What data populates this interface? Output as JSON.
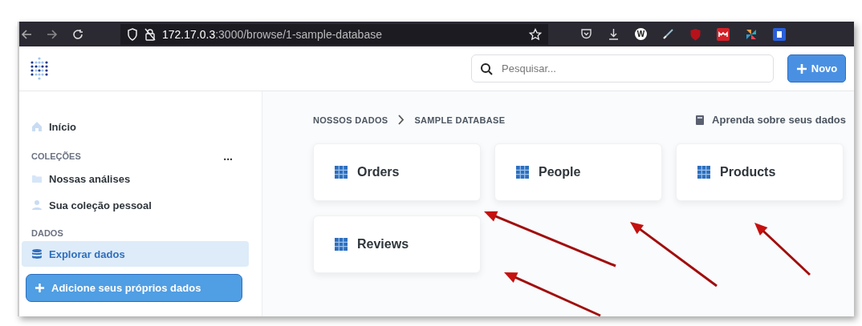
{
  "browser": {
    "url_host": "172.17.0.3",
    "url_path": ":3000/browse/1-sample-database",
    "extension_letter": "W"
  },
  "header": {
    "search": {
      "placeholder": "Pesquisar..."
    },
    "new_button": "Novo"
  },
  "sidebar": {
    "items": [
      {
        "kind": "home",
        "label": "Início",
        "selected": false
      },
      {
        "kind": "heading",
        "label": "COLEÇÕES",
        "menu": "..."
      },
      {
        "kind": "folder",
        "label": "Nossas análises",
        "selected": false
      },
      {
        "kind": "person",
        "label": "Sua coleção pessoal",
        "selected": false
      },
      {
        "kind": "heading",
        "label": "DADOS"
      },
      {
        "kind": "database",
        "label": "Explorar dados",
        "selected": true
      }
    ],
    "add_button": "Adicione seus próprios dados"
  },
  "main": {
    "breadcrumb": [
      "NOSSOS DADOS",
      "SAMPLE DATABASE"
    ],
    "learn_link": "Aprenda sobre seus dados",
    "tables": [
      {
        "name": "Orders"
      },
      {
        "name": "People"
      },
      {
        "name": "Products"
      },
      {
        "name": "Reviews"
      }
    ]
  }
}
